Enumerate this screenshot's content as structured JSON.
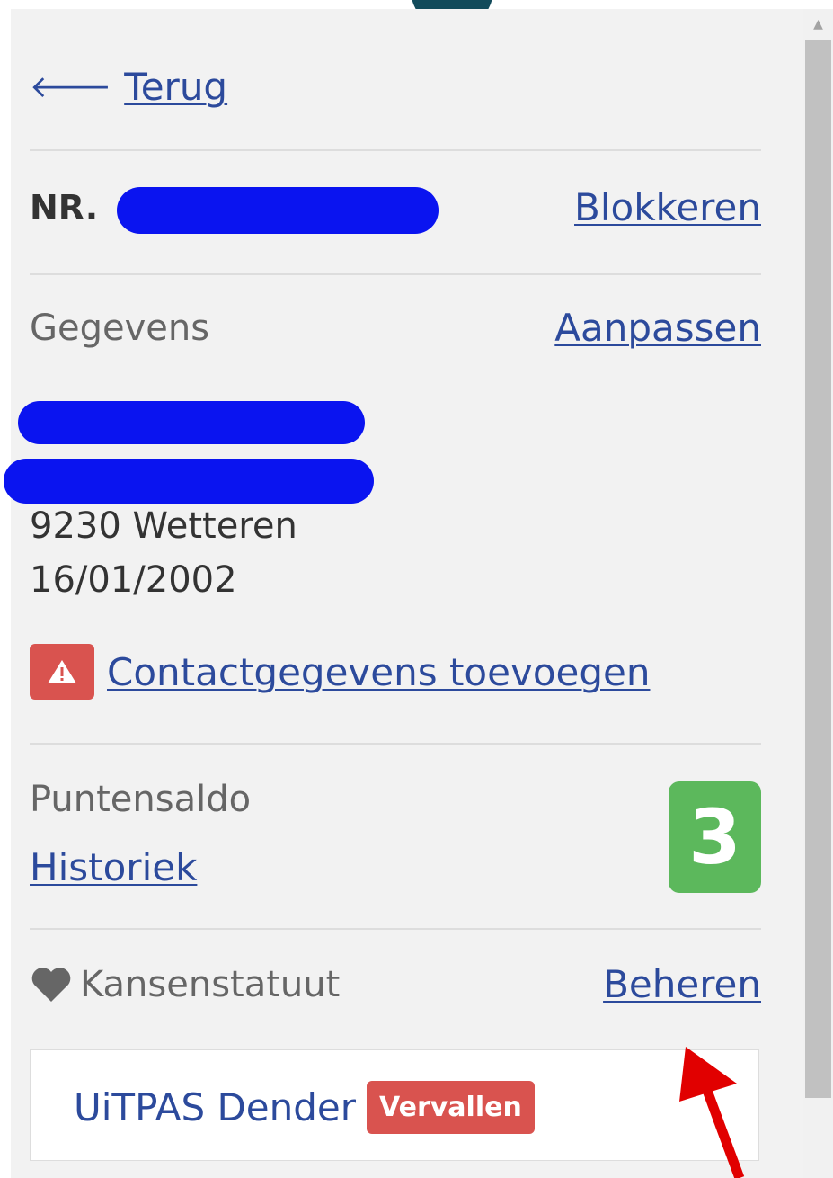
{
  "back": {
    "label": "Terug"
  },
  "card_number": {
    "prefix": "NR.",
    "block_label": "Blokkeren"
  },
  "details": {
    "heading": "Gegevens",
    "edit_label": "Aanpassen",
    "city": "9230 Wetteren",
    "birthdate": "16/01/2002",
    "add_contact_label": "Contactgegevens toevoegen"
  },
  "points": {
    "heading": "Puntensaldo",
    "history_label": "Historiek",
    "balance": "3"
  },
  "kansenstatuut": {
    "heading": "Kansenstatuut",
    "manage_label": "Beheren",
    "card_name": "UiTPAS Dender",
    "status": "Vervallen"
  },
  "colors": {
    "link": "#2c4a9c",
    "danger": "#d9534f",
    "success": "#5cb85c",
    "redaction": "#0a14f0",
    "annotation_arrow": "#e10000"
  }
}
